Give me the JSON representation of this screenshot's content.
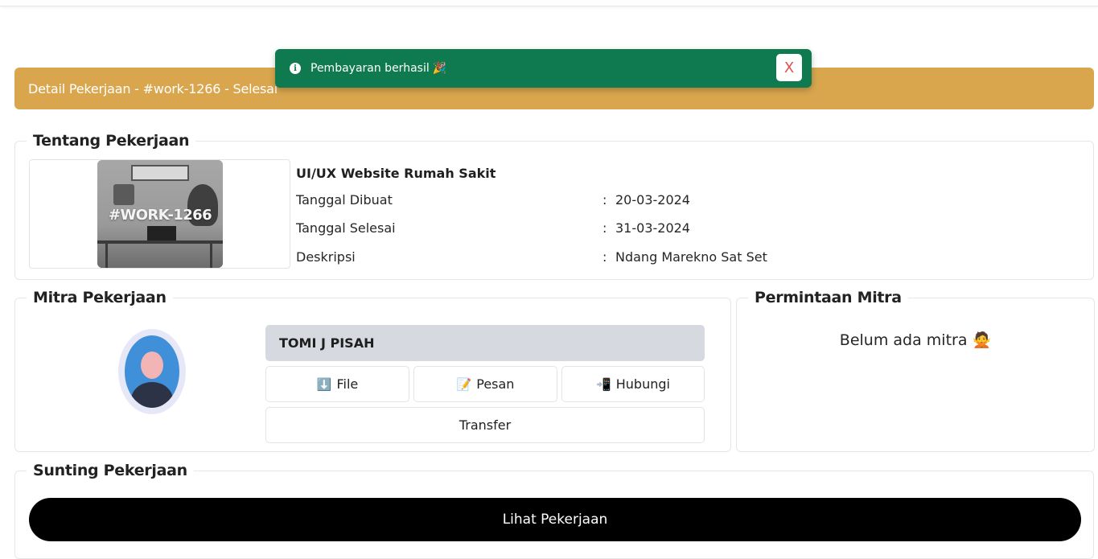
{
  "header": {
    "title": "Detail Pekerjaan - #work-1266 - Selesai"
  },
  "toast": {
    "message": "Pembayaran berhasil",
    "emoji": "🎉",
    "close_label": "X"
  },
  "about": {
    "heading": "Tentang Pekerjaan",
    "thumbnail_label": "#WORK-1266",
    "job_title": "UI/UX Website Rumah Sakit",
    "rows": [
      {
        "key": "Tanggal Dibuat",
        "value": "20-03-2024"
      },
      {
        "key": "Tanggal Selesai",
        "value": "31-03-2024"
      },
      {
        "key": "Deskripsi",
        "value": "Ndang Marekno Sat Set"
      }
    ]
  },
  "partner": {
    "heading": "Mitra Pekerjaan",
    "name": "TOMI J PISAH",
    "buttons": {
      "file": "File",
      "file_icon": "⬇️",
      "pesan": "Pesan",
      "pesan_icon": "📝",
      "hubungi": "Hubungi",
      "hubungi_icon": "📲",
      "transfer": "Transfer"
    }
  },
  "requests": {
    "heading": "Permintaan Mitra",
    "empty_text": "Belum ada mitra",
    "empty_emoji": "🙅"
  },
  "edit": {
    "heading": "Sunting Pekerjaan",
    "view_button": "Lihat Pekerjaan"
  },
  "colors": {
    "header_bg": "#d9a64e",
    "toast_bg": "#0f7a4f",
    "button_dark": "#000000",
    "name_bar": "#d6d9df"
  }
}
